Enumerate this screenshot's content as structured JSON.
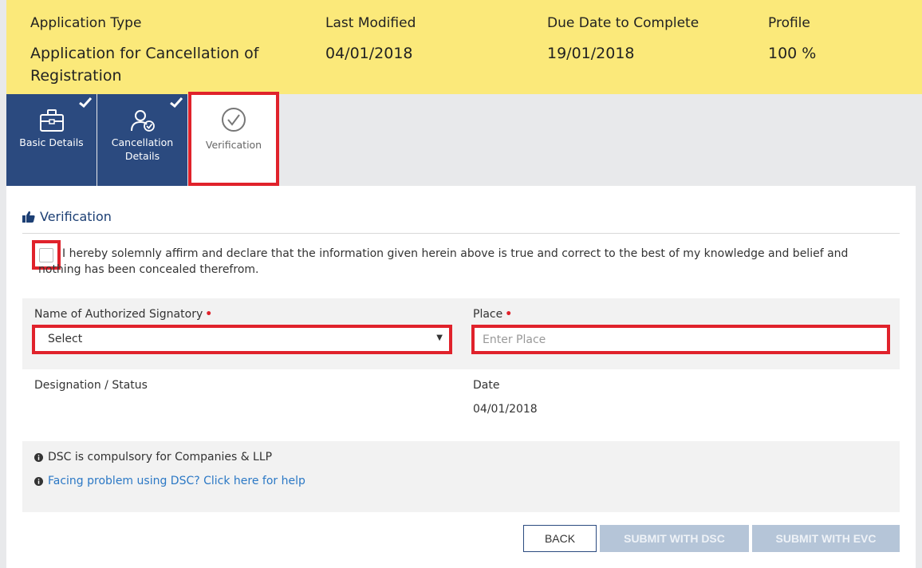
{
  "header": {
    "app_type_label": "Application Type",
    "app_type_value_line1": "Application for Cancellation of",
    "app_type_value_line2": "Registration",
    "last_modified_label": "Last Modified",
    "last_modified_value": "04/01/2018",
    "due_date_label": "Due Date to Complete",
    "due_date_value": "19/01/2018",
    "profile_label": "Profile",
    "profile_value": "100 %"
  },
  "tabs": [
    {
      "label": "Basic Details",
      "icon": "briefcase-icon",
      "completed": true
    },
    {
      "label_line1": "Cancellation",
      "label_line2": "Details",
      "icon": "user-check-icon",
      "completed": true
    },
    {
      "label": "Verification",
      "icon": "check-circle-icon",
      "completed": false,
      "active": true
    }
  ],
  "verification": {
    "section_title": "Verification",
    "affirm_text": "I hereby solemnly affirm and declare that the information given herein above is true and correct to the best of my knowledge and belief and nothing has been concealed therefrom.",
    "signatory_label": "Name of Authorized Signatory",
    "signatory_selected": "Select",
    "place_label": "Place",
    "place_placeholder": "Enter Place",
    "designation_label": "Designation / Status",
    "date_label": "Date",
    "date_value": "04/01/2018"
  },
  "info": {
    "dsc_note": "DSC is compulsory for Companies & LLP",
    "dsc_help_link": "Facing problem using DSC? Click here for help"
  },
  "buttons": {
    "back": "BACK",
    "submit_dsc": "SUBMIT WITH DSC",
    "submit_evc": "SUBMIT WITH EVC"
  },
  "colors": {
    "header_bg": "#fbe97a",
    "tab_done_bg": "#2b4a7f",
    "highlight_red": "#e0222b",
    "link_blue": "#2b78c5",
    "disabled_btn": "#b5c5d8"
  }
}
